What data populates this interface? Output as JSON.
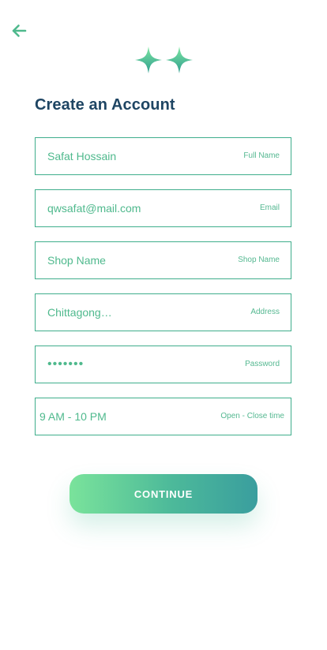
{
  "header": {
    "back_icon": "arrow-left-icon",
    "logo_icon": "double-sparkle-logo-icon"
  },
  "page": {
    "title": "Create an Account"
  },
  "form": {
    "fields": [
      {
        "value": "Safat Hossain",
        "tag": "Full Name"
      },
      {
        "value": "qwsafat@mail.com",
        "tag": "Email"
      },
      {
        "value": "Shop Name",
        "tag": "Shop Name"
      },
      {
        "value": "Chittagong…",
        "tag": "Address"
      },
      {
        "value": "•••••••",
        "tag": "Password"
      },
      {
        "value": "9 AM - 10 PM",
        "tag": "Open - Close time"
      }
    ]
  },
  "actions": {
    "continue_label": "CONTINUE"
  },
  "colors": {
    "accent": "#4fb98d",
    "title": "#1e4563",
    "border": "#3fae8c",
    "button_start": "#7ae39b",
    "button_end": "#3a9e9e"
  }
}
